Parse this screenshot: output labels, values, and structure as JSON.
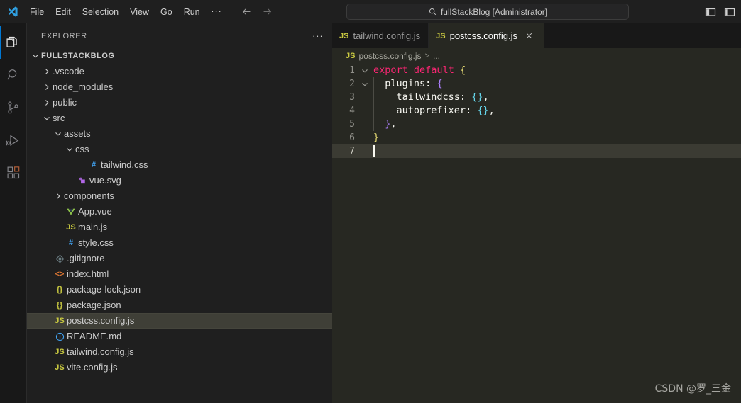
{
  "titlebar": {
    "logo_icon": "vscode-logo-icon",
    "menus": [
      "File",
      "Edit",
      "Selection",
      "View",
      "Go",
      "Run"
    ],
    "more_label": "...",
    "back_icon": "arrow-left-icon",
    "forward_icon": "arrow-right-icon",
    "command_center": {
      "search_icon": "search-icon",
      "value": "fullStackBlog [Administrator]"
    },
    "layout_buttons": [
      {
        "name": "toggle-primary-sidebar",
        "icon": "layout-sidebar-left-icon"
      },
      {
        "name": "toggle-panel",
        "icon": "layout-panel-icon"
      }
    ]
  },
  "activitybar": {
    "items": [
      {
        "name": "explorer",
        "icon": "files-icon",
        "active": true
      },
      {
        "name": "search",
        "icon": "search-icon",
        "active": false
      },
      {
        "name": "source-control",
        "icon": "source-control-icon",
        "active": false
      },
      {
        "name": "run-and-debug",
        "icon": "run-debug-icon",
        "active": false
      },
      {
        "name": "extensions",
        "icon": "extensions-icon",
        "active": false
      }
    ]
  },
  "sidebar": {
    "title": "EXPLORER",
    "more_actions_label": "...",
    "root": {
      "label": "FULLSTACKBLOG",
      "twisty": "chevron-down-icon"
    },
    "tree": [
      {
        "label": ".vscode",
        "depth": 1,
        "twisty": "chevron-right-icon",
        "icon": "",
        "icon_color": "",
        "selected": false
      },
      {
        "label": "node_modules",
        "depth": 1,
        "twisty": "chevron-right-icon",
        "icon": "",
        "icon_color": "",
        "selected": false
      },
      {
        "label": "public",
        "depth": 1,
        "twisty": "chevron-right-icon",
        "icon": "",
        "icon_color": "",
        "selected": false
      },
      {
        "label": "src",
        "depth": 1,
        "twisty": "chevron-down-icon",
        "icon": "",
        "icon_color": "",
        "selected": false
      },
      {
        "label": "assets",
        "depth": 2,
        "twisty": "chevron-down-icon",
        "icon": "",
        "icon_color": "",
        "selected": false
      },
      {
        "label": "css",
        "depth": 3,
        "twisty": "chevron-down-icon",
        "icon": "",
        "icon_color": "",
        "selected": false
      },
      {
        "label": "tailwind.css",
        "depth": 4,
        "twisty": "",
        "icon": "#",
        "icon_color": "#42a5f5",
        "selected": false
      },
      {
        "label": "vue.svg",
        "depth": 3,
        "twisty": "",
        "icon": "svg",
        "icon_color": "#b267e6",
        "selected": false
      },
      {
        "label": "components",
        "depth": 2,
        "twisty": "chevron-right-icon",
        "icon": "",
        "icon_color": "",
        "selected": false
      },
      {
        "label": "App.vue",
        "depth": 2,
        "twisty": "",
        "icon": "vue",
        "icon_color": "#8dc149",
        "selected": false
      },
      {
        "label": "main.js",
        "depth": 2,
        "twisty": "",
        "icon": "JS",
        "icon_color": "#cbcb41",
        "selected": false
      },
      {
        "label": "style.css",
        "depth": 2,
        "twisty": "",
        "icon": "#",
        "icon_color": "#42a5f5",
        "selected": false
      },
      {
        "label": ".gitignore",
        "depth": 1,
        "twisty": "",
        "icon": "git",
        "icon_color": "#6d8086",
        "selected": false
      },
      {
        "label": "index.html",
        "depth": 1,
        "twisty": "",
        "icon": "<>",
        "icon_color": "#e37933",
        "selected": false
      },
      {
        "label": "package-lock.json",
        "depth": 1,
        "twisty": "",
        "icon": "{}",
        "icon_color": "#cbcb41",
        "selected": false
      },
      {
        "label": "package.json",
        "depth": 1,
        "twisty": "",
        "icon": "{}",
        "icon_color": "#cbcb41",
        "selected": false
      },
      {
        "label": "postcss.config.js",
        "depth": 1,
        "twisty": "",
        "icon": "JS",
        "icon_color": "#cbcb41",
        "selected": true
      },
      {
        "label": "README.md",
        "depth": 1,
        "twisty": "",
        "icon": "md",
        "icon_color": "#42a5f5",
        "selected": false
      },
      {
        "label": "tailwind.config.js",
        "depth": 1,
        "twisty": "",
        "icon": "JS",
        "icon_color": "#cbcb41",
        "selected": false
      },
      {
        "label": "vite.config.js",
        "depth": 1,
        "twisty": "",
        "icon": "JS",
        "icon_color": "#cbcb41",
        "selected": false
      }
    ]
  },
  "editor": {
    "tabs": [
      {
        "label": "tailwind.config.js",
        "icon": "JS",
        "active": false,
        "closable": false
      },
      {
        "label": "postcss.config.js",
        "icon": "JS",
        "active": true,
        "closable": true,
        "close_icon": "close-icon"
      }
    ],
    "breadcrumb": {
      "icon": "JS",
      "file": "postcss.config.js",
      "separator": ">",
      "tail": "..."
    },
    "lines": [
      {
        "n": "1",
        "fold": "chevron-down-icon",
        "tokens": [
          {
            "t": "export",
            "c": "tk-key"
          },
          {
            "t": " ",
            "c": "tk-plain"
          },
          {
            "t": "default",
            "c": "tk-key"
          },
          {
            "t": " ",
            "c": "tk-plain"
          },
          {
            "t": "{",
            "c": "tk-brace-y"
          }
        ],
        "indents": [],
        "current": false
      },
      {
        "n": "2",
        "fold": "chevron-down-icon",
        "tokens": [
          {
            "t": "  ",
            "c": "tk-plain"
          },
          {
            "t": "plugins",
            "c": "tk-plain"
          },
          {
            "t": ":",
            "c": "tk-plain"
          },
          {
            "t": " ",
            "c": "tk-plain"
          },
          {
            "t": "{",
            "c": "tk-brace-p"
          }
        ],
        "indents": [
          0
        ],
        "current": false
      },
      {
        "n": "3",
        "fold": "",
        "tokens": [
          {
            "t": "    ",
            "c": "tk-plain"
          },
          {
            "t": "tailwindcss",
            "c": "tk-plain"
          },
          {
            "t": ":",
            "c": "tk-plain"
          },
          {
            "t": " ",
            "c": "tk-plain"
          },
          {
            "t": "{}",
            "c": "tk-brace-b"
          },
          {
            "t": ",",
            "c": "tk-plain"
          }
        ],
        "indents": [
          0,
          1
        ],
        "current": false
      },
      {
        "n": "4",
        "fold": "",
        "tokens": [
          {
            "t": "    ",
            "c": "tk-plain"
          },
          {
            "t": "autoprefixer",
            "c": "tk-plain"
          },
          {
            "t": ":",
            "c": "tk-plain"
          },
          {
            "t": " ",
            "c": "tk-plain"
          },
          {
            "t": "{}",
            "c": "tk-brace-b"
          },
          {
            "t": ",",
            "c": "tk-plain"
          }
        ],
        "indents": [
          0,
          1
        ],
        "current": false
      },
      {
        "n": "5",
        "fold": "",
        "tokens": [
          {
            "t": "  ",
            "c": "tk-plain"
          },
          {
            "t": "}",
            "c": "tk-brace-p"
          },
          {
            "t": ",",
            "c": "tk-plain"
          }
        ],
        "indents": [
          0
        ],
        "current": false
      },
      {
        "n": "6",
        "fold": "",
        "tokens": [
          {
            "t": "}",
            "c": "tk-brace-y"
          }
        ],
        "indents": [],
        "current": false
      },
      {
        "n": "7",
        "fold": "",
        "tokens": [],
        "indents": [],
        "current": true,
        "cursor": true
      }
    ]
  },
  "watermark": "CSDN @罗_三金",
  "colors": {
    "editor_bg": "#272822",
    "sidebar_bg": "#1f1f1f",
    "activitybar_bg": "#181818",
    "accent": "#0078d4",
    "current_line": "#3b3b33",
    "selected_row": "#3f3f37",
    "js_icon": "#cbcb41"
  }
}
